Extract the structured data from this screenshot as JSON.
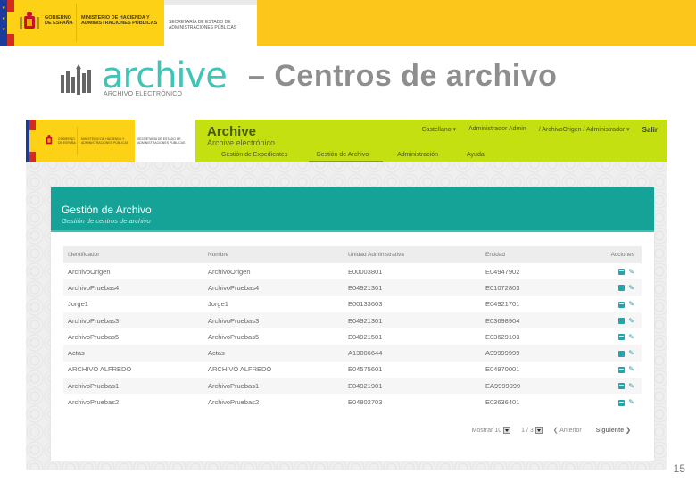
{
  "gov_banner": {
    "gobierno": "GOBIERNO DE ESPAÑA",
    "ministerio": "MINISTERIO DE HACIENDA Y ADMINISTRACIONES PÚBLICAS",
    "secretaria": "SECRETARÍA DE ESTADO DE ADMINISTRACIONES PÚBLICAS"
  },
  "logo": {
    "word": "archive",
    "sub": "ARCHIVO ELECTRÓNICO"
  },
  "slide_title": "– Centros de archivo",
  "app": {
    "title": "Archive",
    "subtitle": "Archive electrónico",
    "topnav": {
      "language": "Castellano ▾",
      "user": "Administrador Admin",
      "context": "/ ArchivoOrigen / Administrador ▾",
      "logout": "Salir"
    },
    "mainnav": [
      {
        "label": "Gestión de Expedientes"
      },
      {
        "label": "Gestión de Archivo"
      },
      {
        "label": "Administración"
      },
      {
        "label": "Ayuda"
      }
    ]
  },
  "panel": {
    "title": "Gestión de Archivo",
    "subtitle": "Gestión de centros de archivo"
  },
  "table": {
    "headers": [
      "Identificador",
      "Nombre",
      "Unidad Administrativa",
      "Entidad",
      "Acciones"
    ],
    "rows": [
      [
        "ArchivoOrigen",
        "ArchivoOrigen",
        "E00003801",
        "E04947902"
      ],
      [
        "ArchivoPruebas4",
        "ArchivoPruebas4",
        "E04921301",
        "E01072803"
      ],
      [
        "Jorge1",
        "Jorge1",
        "E00133603",
        "E04921701"
      ],
      [
        "ArchivoPruebas3",
        "ArchivoPruebas3",
        "E04921301",
        "E03698904"
      ],
      [
        "ArchivoPruebas5",
        "ArchivoPruebas5",
        "E04921501",
        "E03629103"
      ],
      [
        "Actas",
        "Actas",
        "A13006644",
        "A99999999"
      ],
      [
        "ARCHIVO ALFREDO",
        "ARCHIVO ALFREDO",
        "E04575601",
        "E04970001"
      ],
      [
        "ArchivoPruebas1",
        "ArchivoPruebas1",
        "E04921901",
        "EA9999999"
      ],
      [
        "ArchivoPruebas2",
        "ArchivoPruebas2",
        "E04802703",
        "E03636401"
      ]
    ],
    "row_actions": {
      "view_icon": "document-icon",
      "edit_icon": "pencil-icon"
    }
  },
  "pager": {
    "show_label": "Mostrar",
    "page_size": "10",
    "page_of": "1 / 3",
    "prev": "❮ Anterior",
    "next": "Siguiente ❯"
  },
  "page_number": "15",
  "colors": {
    "gov_yellow": "#fcd116",
    "app_green": "#c5e010",
    "teal": "#15a398",
    "logo_teal": "#3fc5b5"
  }
}
